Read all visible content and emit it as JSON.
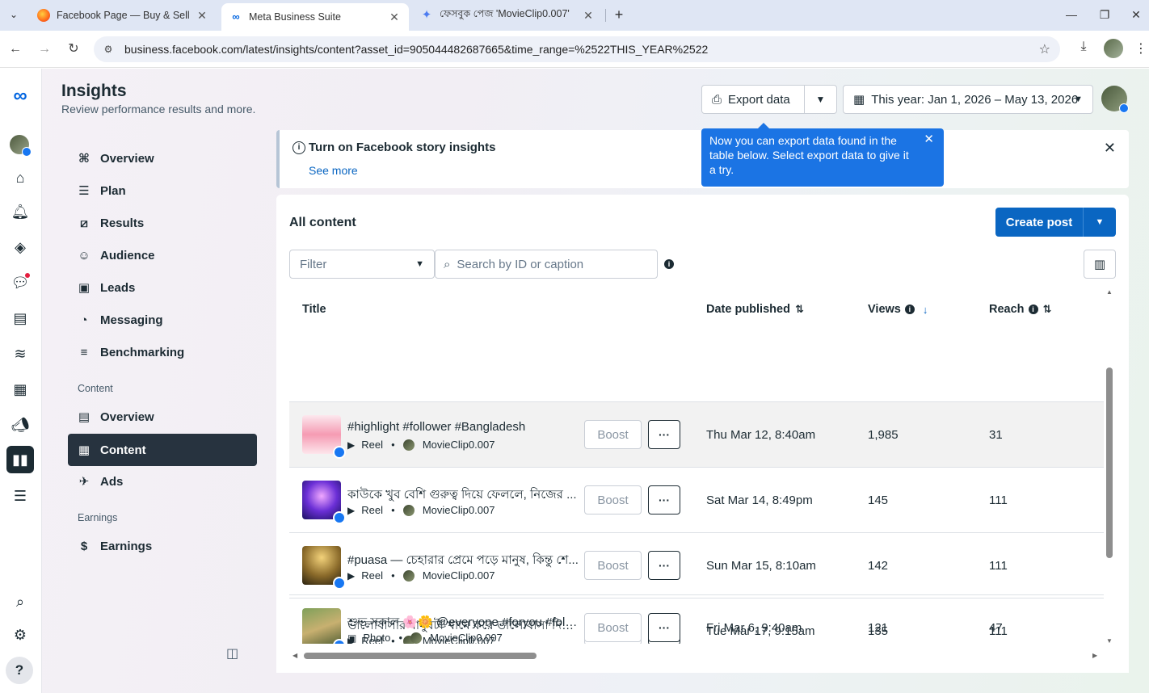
{
  "browser": {
    "tabs": [
      {
        "label": "Facebook Page — Buy & Sell on",
        "active": false
      },
      {
        "label": "Meta Business Suite",
        "active": true
      },
      {
        "label": "ফেসবুক পেজ 'MovieClip0.007'",
        "active": false
      }
    ],
    "url": "business.facebook.com/latest/insights/content?asset_id=905044482687665&time_range=%2522THIS_YEAR%2522"
  },
  "header": {
    "title": "Insights",
    "subtitle": "Review performance results and more.",
    "export_label": "Export data",
    "date_range": "This year: Jan 1, 2026 – May 13, 2026"
  },
  "sidebar": {
    "items": [
      {
        "label": "Overview",
        "icon": "overview-icon"
      },
      {
        "label": "Plan",
        "icon": "plan-icon"
      },
      {
        "label": "Results",
        "icon": "results-icon"
      },
      {
        "label": "Audience",
        "icon": "audience-icon"
      },
      {
        "label": "Leads",
        "icon": "leads-icon"
      },
      {
        "label": "Messaging",
        "icon": "messaging-icon"
      },
      {
        "label": "Benchmarking",
        "icon": "benchmarking-icon"
      }
    ],
    "content_section": "Content",
    "content_items": [
      {
        "label": "Overview",
        "icon": "content-overview-icon"
      },
      {
        "label": "Content",
        "icon": "content-table-icon",
        "active": true
      },
      {
        "label": "Ads",
        "icon": "ads-icon"
      }
    ],
    "earnings_section": "Earnings",
    "earnings_items": [
      {
        "label": "Earnings",
        "icon": "dollar-icon"
      }
    ]
  },
  "banner": {
    "title": "Turn on Facebook story insights",
    "link": "See more"
  },
  "tooltip": {
    "text": "Now you can export data found in the table below. Select export data to give it a try."
  },
  "content": {
    "title": "All content",
    "create_label": "Create post",
    "filter_placeholder": "Filter",
    "search_placeholder": "Search by ID or caption",
    "columns": {
      "title": "Title",
      "date": "Date published",
      "views": "Views",
      "reach": "Reach"
    },
    "boost_label": "Boost",
    "more_label": "···",
    "rows": [
      {
        "caption": "#highlight #follower #Bangladesh",
        "type": "Reel",
        "page": "MovieClip0.007",
        "date": "Thu Mar 12, 8:40am",
        "views": "1,985",
        "reach": "31"
      },
      {
        "caption": "কাউকে খুব বেশি গুরুত্ব দিয়ে ফেললে, নিজের ...",
        "type": "Reel",
        "page": "MovieClip0.007",
        "date": "Sat Mar 14, 8:49pm",
        "views": "145",
        "reach": "111"
      },
      {
        "caption": "#puasa — চেহারার প্রেমে পড়ে মানুষ, কিন্তু শে...",
        "type": "Reel",
        "page": "MovieClip0.007",
        "date": "Sun Mar 15, 8:10am",
        "views": "142",
        "reach": "111"
      },
      {
        "caption": "ভালোবাসার মানুষটা খামে করে ভালোবাসা দিলো...",
        "type": "Reel",
        "page": "MovieClip0.007",
        "date": "Tue Mar 17, 9:15am",
        "views": "135",
        "reach": "111"
      },
      {
        "caption": "শুভ সকাল 🌸🌼 @everyone #foryou #follo...",
        "type": "Photo",
        "page": "MovieClip0.007",
        "date": "Fri Mar 6, 9:40am",
        "views": "121",
        "reach": "47"
      }
    ]
  },
  "colors": {
    "accent": "#0a66c2",
    "tooltip": "#1b74e4",
    "nav_active": "#27333f"
  }
}
